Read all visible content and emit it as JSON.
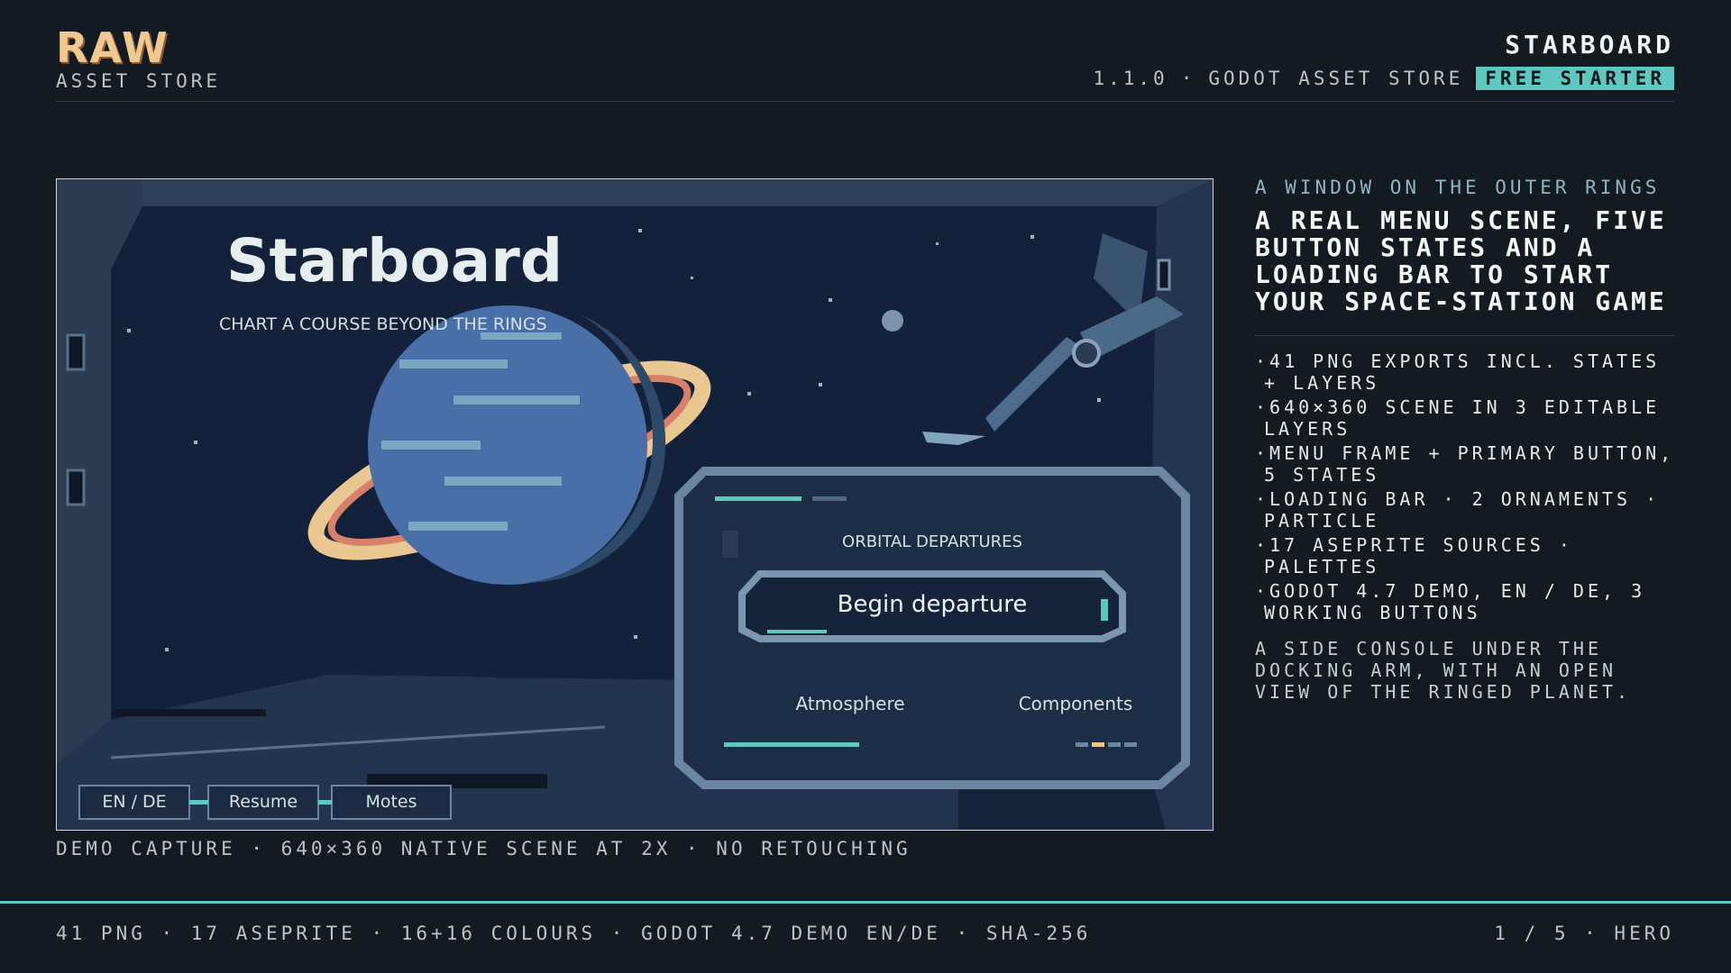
{
  "brand": {
    "logo": "RAW",
    "subtitle": "ASSET STORE"
  },
  "header": {
    "product": "STARBOARD",
    "version": "1.1.0",
    "separator": "·",
    "store": "GODOT ASSET STORE",
    "badge": "FREE STARTER"
  },
  "scene": {
    "title": "Starboard",
    "tagline": "CHART A COURSE BEYOND THE RINGS",
    "panel_title": "ORBITAL DEPARTURES",
    "primary_button": "Begin departure",
    "tab_left": "Atmosphere",
    "tab_right": "Components",
    "bottom_buttons": [
      "EN / DE",
      "Resume",
      "Motes"
    ]
  },
  "preview_caption": "DEMO CAPTURE · 640×360 NATIVE SCENE AT 2X · NO RETOUCHING",
  "side": {
    "kicker": "A WINDOW ON THE OUTER RINGS",
    "headline": "A REAL MENU SCENE, FIVE BUTTON STATES AND A LOADING BAR TO START YOUR SPACE-STATION GAME",
    "features": [
      "·41 PNG EXPORTS INCL. STATES + LAYERS",
      "·640×360 SCENE IN 3 EDITABLE LAYERS",
      "·MENU FRAME + PRIMARY BUTTON, 5 STATES",
      "·LOADING BAR · 2 ORNAMENTS · PARTICLE",
      "·17 ASEPRITE SOURCES · PALETTES",
      "·GODOT 4.7 DEMO, EN / DE, 3 WORKING BUTTONS"
    ],
    "blurb": "A SIDE CONSOLE UNDER THE DOCKING ARM, WITH AN OPEN VIEW OF THE RINGED PLANET."
  },
  "footer": {
    "stats": "41 PNG · 17 ASEPRITE · 16+16 COLOURS · GODOT 4.7 DEMO EN/DE · SHA-256",
    "page": "1 / 5 · HERO"
  },
  "colors": {
    "accent": "#5ec8c0",
    "background": "#131a22",
    "logo": "#f0c890"
  },
  "icons": [
    "planet-icon",
    "docking-arm-icon"
  ]
}
